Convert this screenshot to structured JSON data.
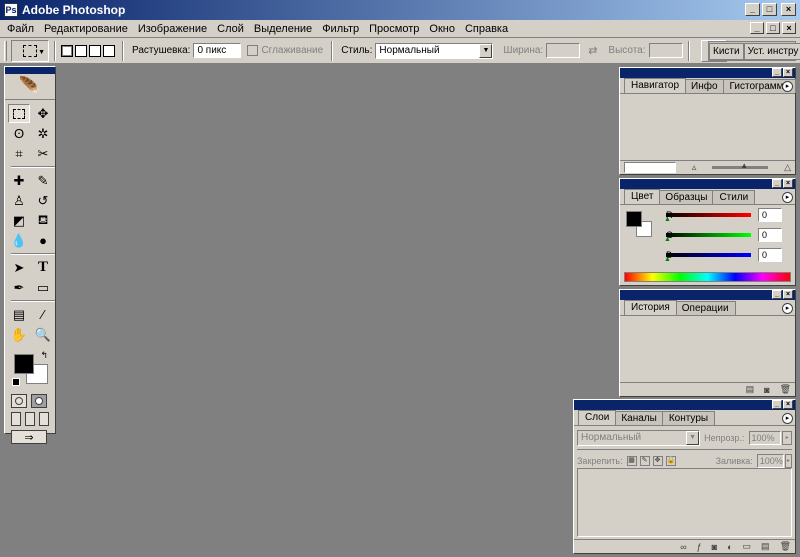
{
  "window": {
    "title": "Adobe Photoshop",
    "minimize": "_",
    "maximize": "□",
    "close": "×"
  },
  "menu": [
    "Файл",
    "Редактирование",
    "Изображение",
    "Слой",
    "Выделение",
    "Фильтр",
    "Просмотр",
    "Окно",
    "Справка"
  ],
  "options": {
    "feather_label": "Растушевка:",
    "feather_value": "0 пикс",
    "antialias_label": "Сглаживание",
    "style_label": "Стиль:",
    "style_value": "Нормальный",
    "width_label": "Ширина:",
    "height_label": "Высота:",
    "palette_well_tab": "Кисти",
    "palette_well_tab2": "Уст. инстру"
  },
  "navigator": {
    "tabs": [
      "Навигатор",
      "Инфо",
      "Гистограмма"
    ]
  },
  "color": {
    "tabs": [
      "Цвет",
      "Образцы",
      "Стили"
    ],
    "channels": [
      {
        "label": "R",
        "value": "0",
        "gradient": "#ff0000"
      },
      {
        "label": "G",
        "value": "0",
        "gradient": "#00ff00"
      },
      {
        "label": "B",
        "value": "0",
        "gradient": "#0000ff"
      }
    ]
  },
  "history": {
    "tabs": [
      "История",
      "Операции"
    ]
  },
  "layers": {
    "tabs": [
      "Слои",
      "Каналы",
      "Контуры"
    ],
    "blend_mode": "Нормальный",
    "opacity_label": "Непрозр.:",
    "opacity_value": "100%",
    "lock_label": "Закрепить:",
    "fill_label": "Заливка:",
    "fill_value": "100%"
  }
}
